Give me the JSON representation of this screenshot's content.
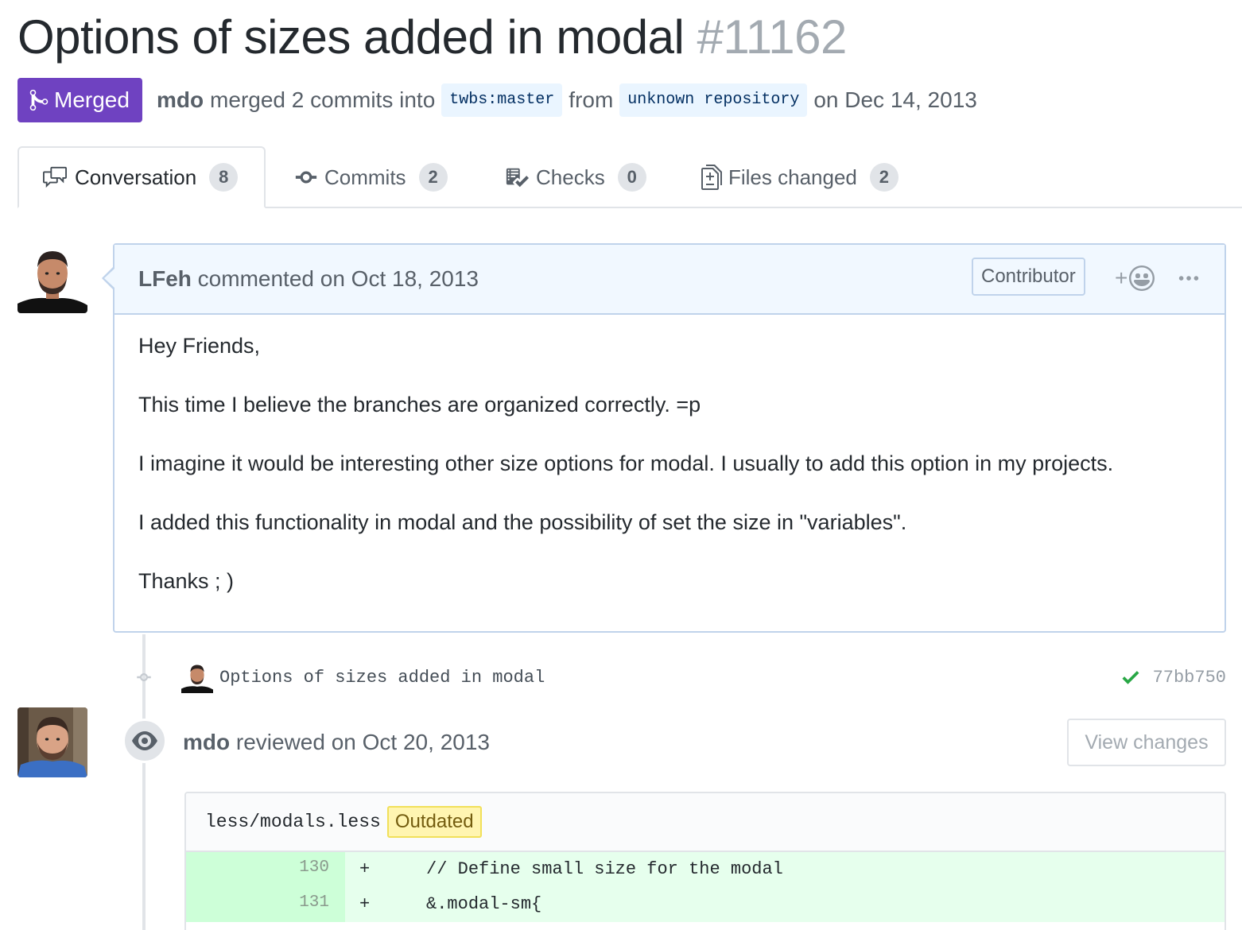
{
  "pr": {
    "title": "Options of sizes added in modal",
    "number": "#11162",
    "state": "Merged",
    "author": "mdo",
    "merge_text": "merged 2 commits into",
    "base_branch": "twbs:master",
    "from_text": "from",
    "head_branch": "unknown repository",
    "date_text": "on Dec 14, 2013"
  },
  "tabs": [
    {
      "label": "Conversation",
      "count": "8",
      "icon": "comment-discussion-icon"
    },
    {
      "label": "Commits",
      "count": "2",
      "icon": "git-commit-icon"
    },
    {
      "label": "Checks",
      "count": "0",
      "icon": "checklist-icon"
    },
    {
      "label": "Files changed",
      "count": "2",
      "icon": "file-diff-icon"
    }
  ],
  "comment": {
    "author": "LFeh",
    "action": "commented on Oct 18, 2013",
    "label": "Contributor",
    "reaction_plus": "+",
    "body": [
      "Hey Friends,",
      "This time I believe the branches are organized correctly. =p",
      "I imagine it would be interesting other size options for modal. I usually to add this option in my projects.",
      "I added this functionality in modal and the possibility of set the size in \"variables\".",
      "Thanks ; )"
    ]
  },
  "commit": {
    "message": "Options of sizes added in modal",
    "sha": "77bb750",
    "status": "success"
  },
  "review": {
    "author": "mdo",
    "action": "reviewed on Oct 20, 2013",
    "button": "View changes"
  },
  "file": {
    "path": "less/modals.less",
    "badge": "Outdated",
    "lines": [
      {
        "num": "130",
        "sign": "+",
        "code": "    // Define small size for the modal"
      },
      {
        "num": "131",
        "sign": "+",
        "code": "    &.modal-sm{"
      }
    ]
  },
  "colors": {
    "merged": "#6f42c1",
    "success": "#28a745",
    "diff_add_bg": "#e6ffed",
    "diff_add_num_bg": "#cdffd8"
  }
}
